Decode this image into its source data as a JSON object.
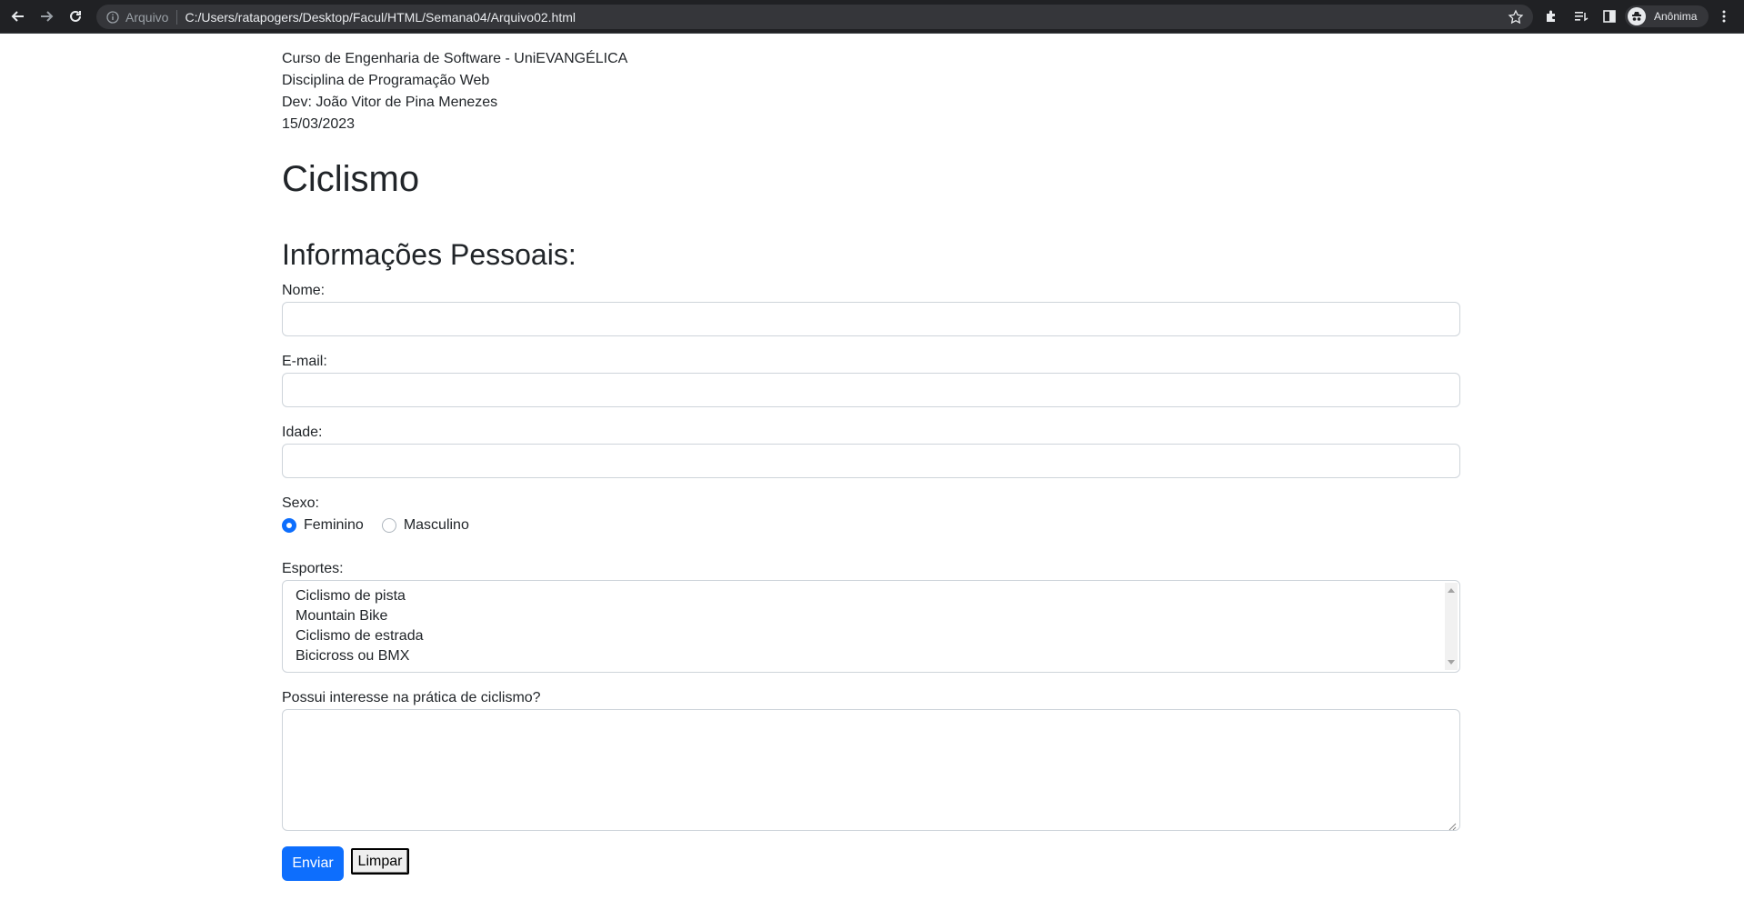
{
  "browser": {
    "scheme_label": "Arquivo",
    "url": "C:/Users/ratapogers/Desktop/Facul/HTML/Semana04/Arquivo02.html",
    "profile_name": "Anônima"
  },
  "page": {
    "meta": {
      "course": "Curso de Engenharia de Software - UniEVANGÉLICA",
      "discipline": "Disciplina de Programação Web",
      "dev": "Dev: João Vitor de Pina Menezes",
      "date": "15/03/2023"
    },
    "title": "Ciclismo",
    "section_title": "Informações Pessoais:",
    "form": {
      "name_label": "Nome:",
      "name_value": "",
      "email_label": "E-mail:",
      "email_value": "",
      "age_label": "Idade:",
      "age_value": "",
      "sex_label": "Sexo:",
      "sex_options": [
        "Feminino",
        "Masculino"
      ],
      "sex_selected": "Feminino",
      "sports_label": "Esportes:",
      "sports_options": [
        "Ciclismo de pista",
        "Mountain Bike",
        "Ciclismo de estrada",
        "Bicicross ou BMX"
      ],
      "interest_label": "Possui interesse na prática de ciclismo?",
      "interest_value": "",
      "submit_label": "Enviar",
      "reset_label": "Limpar"
    }
  },
  "colors": {
    "primary": "#0d6efd",
    "toolbar_bg": "#202124",
    "omnibox_bg": "#35363a"
  }
}
